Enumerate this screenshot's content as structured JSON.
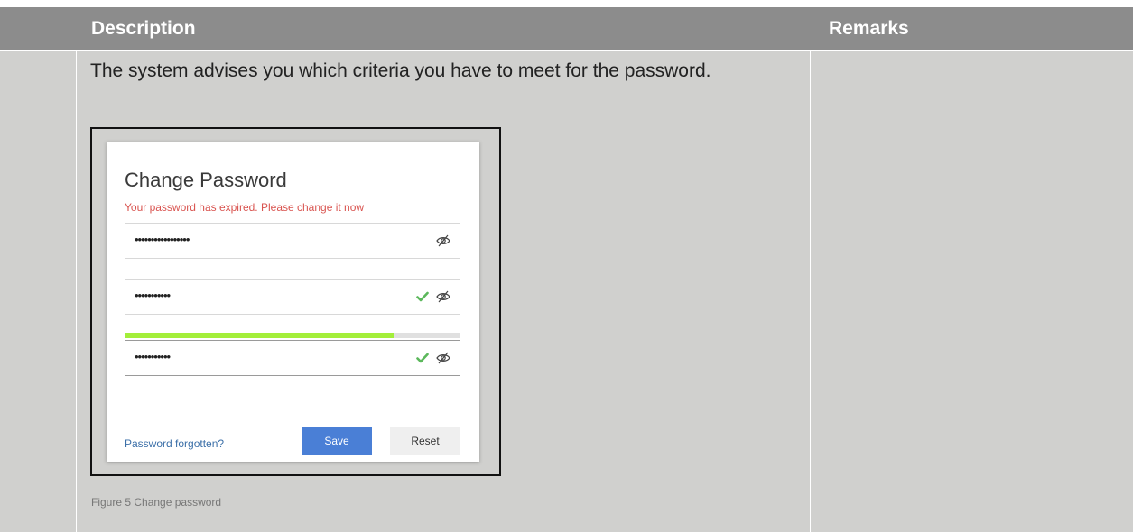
{
  "table": {
    "headers": {
      "description": "Description",
      "remarks": "Remarks"
    },
    "row": {
      "description_text": "The system advises you which criteria you have to meet for the password.",
      "remarks_text": ""
    }
  },
  "figure": {
    "dialog": {
      "title": "Change Password",
      "error_message": "Your password has expired. Please change it now",
      "fields": [
        {
          "masked_value": "•••••••••••••••••",
          "valid": false,
          "focused": false
        },
        {
          "masked_value": "•••••••••••",
          "valid": true,
          "focused": false
        },
        {
          "masked_value": "•••••••••••",
          "valid": true,
          "focused": true
        }
      ],
      "strength_fraction": 0.8,
      "forgot_link": "Password forgotten?",
      "save_label": "Save",
      "reset_label": "Reset"
    },
    "caption": "Figure 5 Change password"
  },
  "colors": {
    "header_bg": "#8c8c8c",
    "cell_bg": "#d0d0ce",
    "error": "#d9534f",
    "primary_button": "#4a7fd6",
    "strength_fill": "#a3ee3a",
    "check": "#5cb85c",
    "link": "#3b6fa8"
  },
  "icons": {
    "visibility_toggle": "eye-slash-icon",
    "valid": "check-icon"
  }
}
